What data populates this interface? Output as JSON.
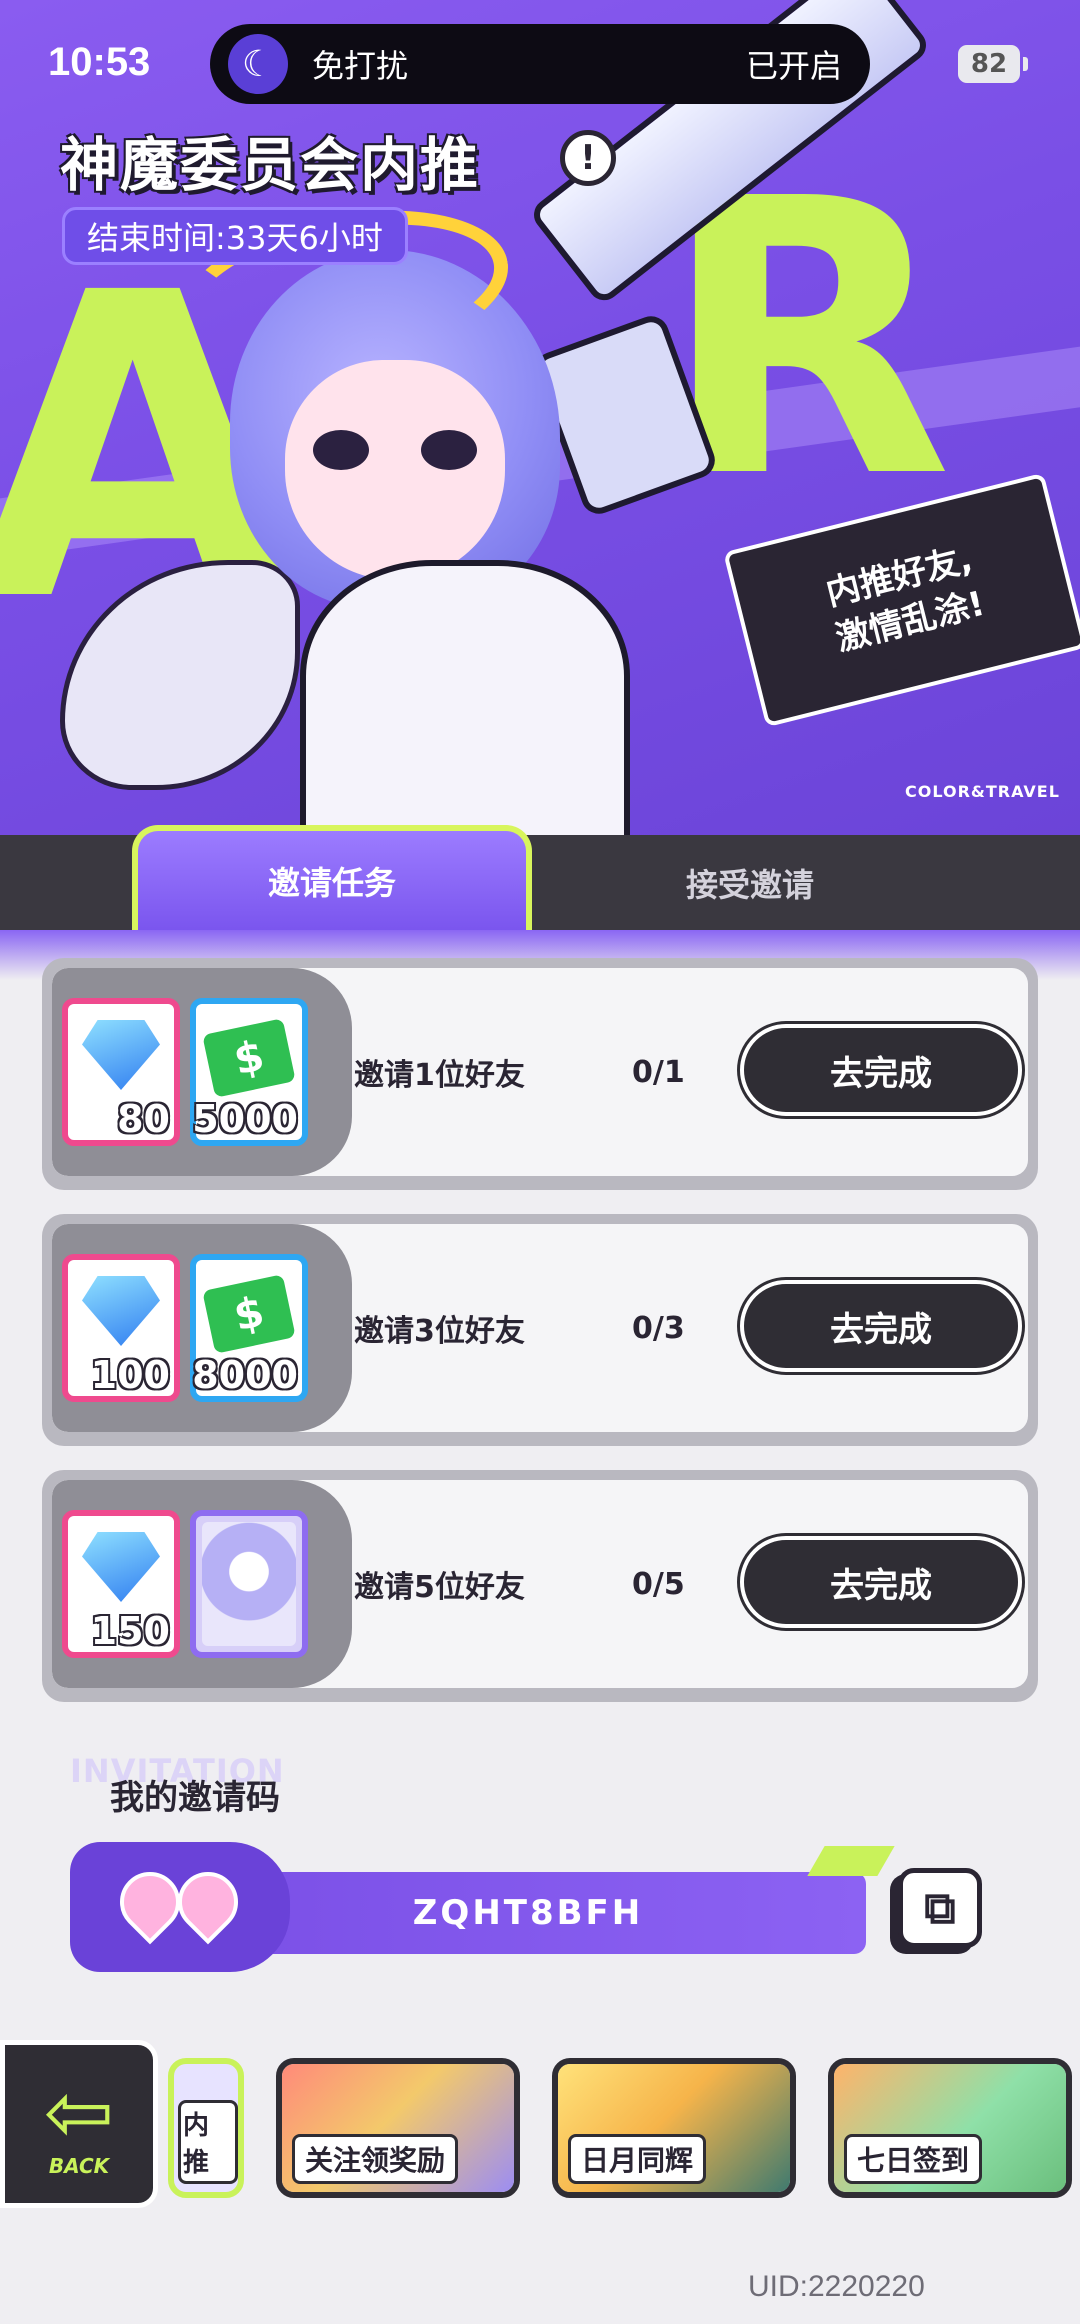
{
  "status_bar": {
    "time": "10:53",
    "dnd_label": "免打扰",
    "dnd_state": "已开启",
    "battery": "82"
  },
  "hero": {
    "title": "神魔委员会内推",
    "end_time": "结束时间:33天6小时",
    "slogan_line1": "内推好友,",
    "slogan_line2": "激情乱涂!",
    "brand": "COLOR&TRAVEL"
  },
  "tabs": [
    {
      "label": "邀请任务",
      "active": true
    },
    {
      "label": "接受邀请",
      "active": false
    }
  ],
  "tasks": [
    {
      "name": "邀请1位好友",
      "progress": "0/1",
      "button": "去完成",
      "rewards": [
        {
          "icon": "diamond-icon",
          "qty": "80"
        },
        {
          "icon": "cash-icon",
          "qty": "5000"
        }
      ]
    },
    {
      "name": "邀请3位好友",
      "progress": "0/3",
      "button": "去完成",
      "rewards": [
        {
          "icon": "diamond-icon",
          "qty": "100"
        },
        {
          "icon": "cash-icon",
          "qty": "8000"
        }
      ]
    },
    {
      "name": "邀请5位好友",
      "progress": "0/5",
      "button": "去完成",
      "rewards": [
        {
          "icon": "diamond-icon",
          "qty": "150"
        },
        {
          "icon": "character-portrait",
          "qty": ""
        }
      ]
    }
  ],
  "invite": {
    "watermark": "INVITATION",
    "title": "我的邀请码",
    "code": "ZQHT8BFH"
  },
  "bottom_nav": {
    "back_label": "BACK",
    "items": [
      {
        "label": "内推"
      },
      {
        "label": "关注领奖励"
      },
      {
        "label": "日月同辉"
      },
      {
        "label": "七日签到"
      }
    ]
  },
  "uid": "UID:2220220",
  "colors": {
    "accent_purple": "#7a4fe6",
    "accent_lime": "#c9f25a",
    "dark": "#2f2d34"
  }
}
